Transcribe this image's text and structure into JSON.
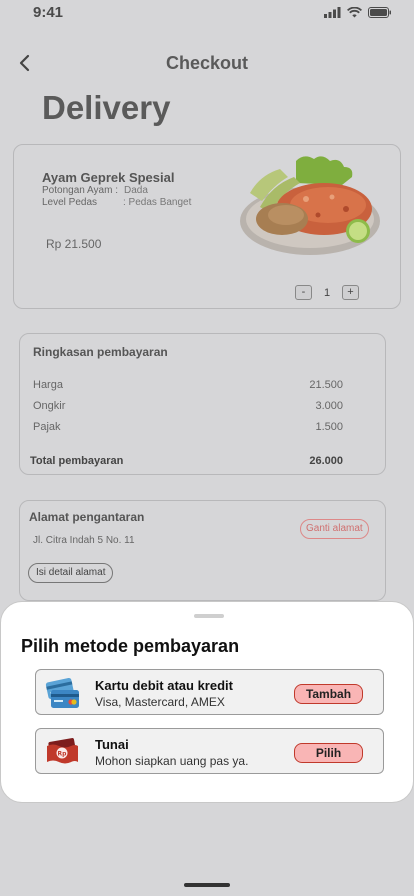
{
  "status": {
    "time": "9:41"
  },
  "header": {
    "title": "Checkout"
  },
  "page": {
    "title": "Delivery"
  },
  "product": {
    "name": "Ayam Geprek Spesial",
    "opt1_label": "Potongan Ayam :",
    "opt1_value": "Dada",
    "opt2_label": "Level Pedas",
    "opt2_value": ": Pedas Banget",
    "price": "Rp 21.500",
    "qty_minus": "-",
    "qty": "1",
    "qty_plus": "+"
  },
  "summary": {
    "title": "Ringkasan pembayaran",
    "rows": [
      {
        "label": "Harga",
        "value": "21.500"
      },
      {
        "label": "Ongkir",
        "value": "3.000"
      },
      {
        "label": "Pajak",
        "value": "1.500"
      }
    ],
    "total_label": "Total pembayaran",
    "total_value": "26.000"
  },
  "address": {
    "title": "Alamat pengantaran",
    "text": "Jl. Citra Indah 5 No. 11",
    "change_label": "Ganti alamat",
    "detail_label": "Isi detail alamat"
  },
  "sheet": {
    "title": "Pilih metode pembayaran",
    "methods": [
      {
        "name": "Kartu debit atau kredit",
        "sub": "Visa, Mastercard, AMEX",
        "button": "Tambah",
        "icon": "credit-card-icon"
      },
      {
        "name": "Tunai",
        "sub": "Mohon siapkan uang pas ya.",
        "button": "Pilih",
        "icon": "cash-icon"
      }
    ]
  },
  "colors": {
    "accent": "#f9b5b5",
    "accent_border": "#c0392b",
    "overlay": "#d6d6d8"
  }
}
